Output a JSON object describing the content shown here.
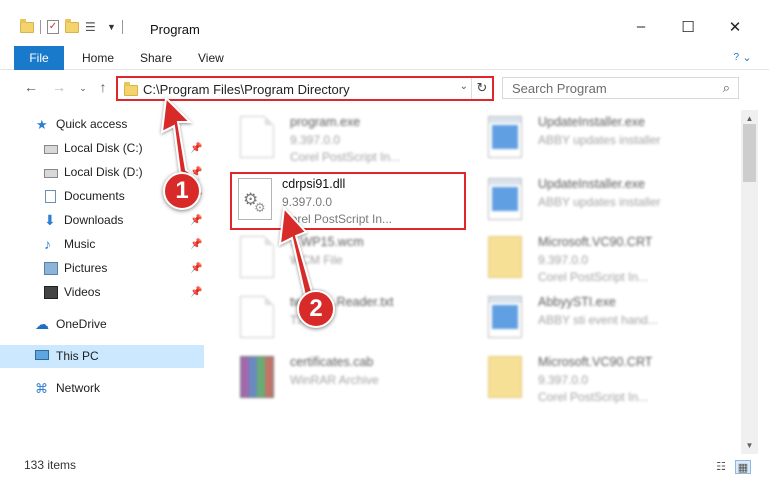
{
  "window": {
    "title": "Program",
    "controls": {
      "minimize": "–",
      "maximize": "☐",
      "close": "✕"
    }
  },
  "ribbon": {
    "tabs": [
      {
        "label": "File"
      },
      {
        "label": "Home"
      },
      {
        "label": "Share"
      },
      {
        "label": "View"
      }
    ]
  },
  "navigation": {
    "address": "C:\\Program Files\\Program Directory",
    "search_placeholder": "Search Program"
  },
  "sidebar": {
    "items": [
      {
        "label": "Quick access",
        "icon": "star-icon",
        "pinned": false
      },
      {
        "label": "Local Disk (C:)",
        "icon": "disk-icon",
        "pinned": true
      },
      {
        "label": "Local Disk (D:)",
        "icon": "disk-icon",
        "pinned": true
      },
      {
        "label": "Documents",
        "icon": "documents-icon",
        "pinned": true
      },
      {
        "label": "Downloads",
        "icon": "download-icon",
        "pinned": true
      },
      {
        "label": "Music",
        "icon": "music-icon",
        "pinned": true
      },
      {
        "label": "Pictures",
        "icon": "pictures-icon",
        "pinned": true
      },
      {
        "label": "Videos",
        "icon": "videos-icon",
        "pinned": true
      },
      {
        "label": "OneDrive",
        "icon": "onedrive-icon",
        "pinned": false
      },
      {
        "label": "This PC",
        "icon": "pc-icon",
        "pinned": false,
        "selected": true
      },
      {
        "label": "Network",
        "icon": "network-icon",
        "pinned": false
      }
    ]
  },
  "files": [
    {
      "name": "program.exe",
      "version": "9.397.0.0",
      "description": "Corel PostScript In...",
      "icon": "program-exe-icon"
    },
    {
      "name": "UpdateInstaller.exe",
      "version": "",
      "description": "ABBY updates installer",
      "icon": "exe-icon"
    },
    {
      "name": "cdrpsi91.dll",
      "version": "9.397.0.0",
      "description": "Corel PostScript In...",
      "icon": "dll-gear-icon"
    },
    {
      "name": "UpdateInstaller.exe",
      "version": "",
      "description": "ABBY updates installer",
      "icon": "exe-icon"
    },
    {
      "name": "...WP15.wcm",
      "version": "",
      "description": "WCM File",
      "icon": "blank-file-icon"
    },
    {
      "name": "Microsoft.VC90.CRT",
      "version": "9.397.0.0",
      "description": "Corel PostScript In...",
      "icon": "folder-icon"
    },
    {
      "name": "twain_...Reader.txt",
      "version": "",
      "description": "TXT",
      "icon": "blank-file-icon"
    },
    {
      "name": "AbbyySTI.exe",
      "version": "",
      "description": "ABBY sti event hand...",
      "icon": "exe-icon"
    },
    {
      "name": "certificates.cab",
      "version": "",
      "description": "WinRAR Archive",
      "icon": "winrar-icon"
    },
    {
      "name": "Microsoft.VC90.CRT",
      "version": "9.397.0.0",
      "description": "Corel PostScript In...",
      "icon": "folder-icon"
    }
  ],
  "status": {
    "item_count": "133 items"
  },
  "annotations": [
    {
      "label": "1"
    },
    {
      "label": "2"
    }
  ],
  "colors": {
    "accent": "#1979ca",
    "highlight": "#e0262b",
    "selected": "#cce8ff"
  }
}
